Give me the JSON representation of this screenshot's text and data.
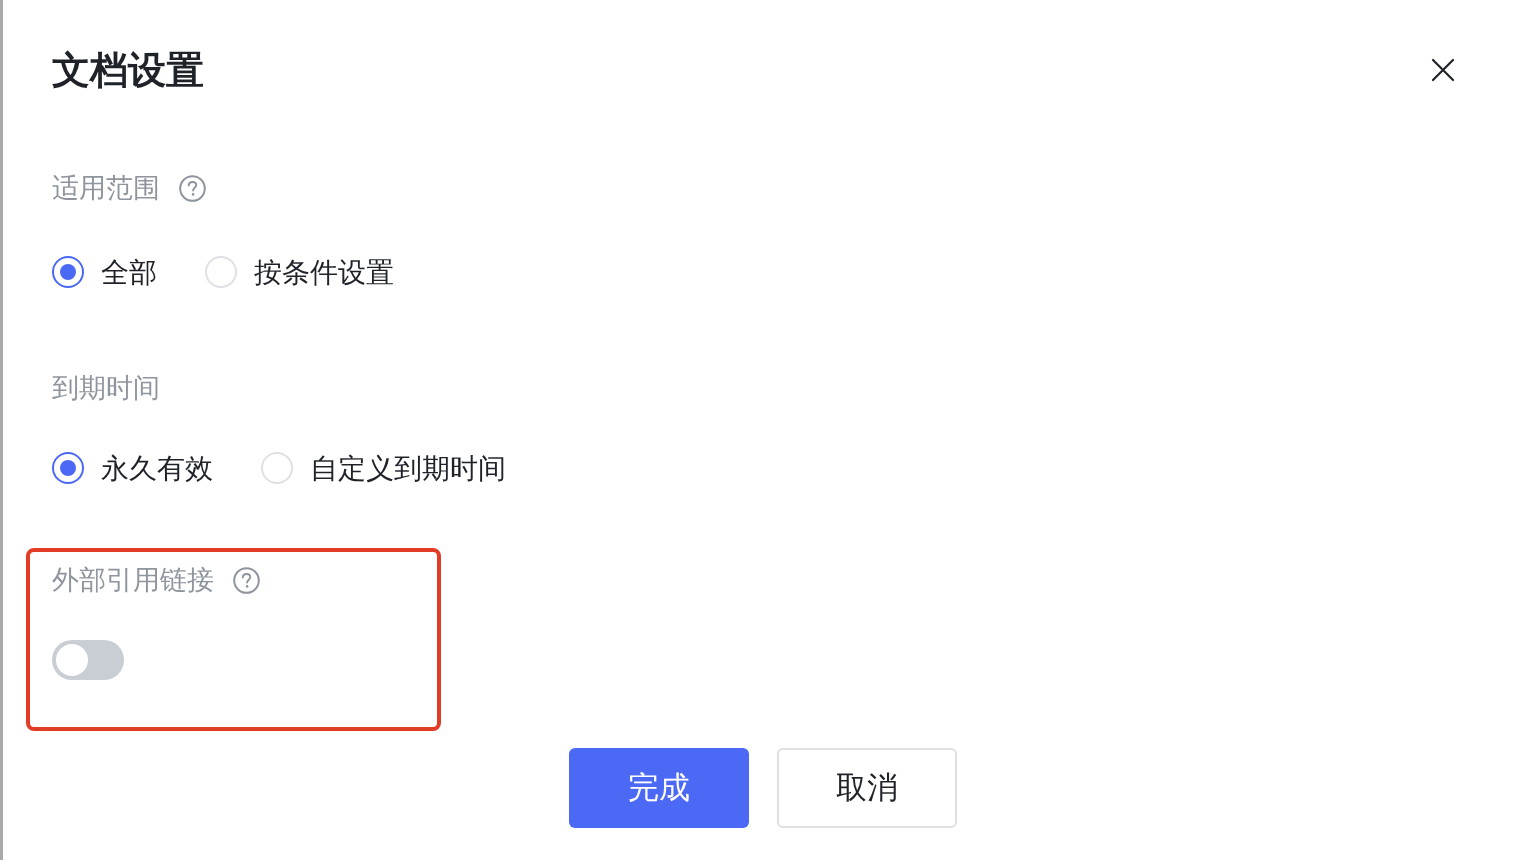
{
  "dialog": {
    "title": "文档设置"
  },
  "sections": [
    {
      "label": "适用范围",
      "help": true,
      "highlighted": false,
      "kind": "radio",
      "options": [
        {
          "label": "全部",
          "selected": true
        },
        {
          "label": "按条件设置",
          "selected": false
        }
      ]
    },
    {
      "label": "到期时间",
      "help": false,
      "highlighted": false,
      "kind": "radio",
      "options": [
        {
          "label": "永久有效",
          "selected": true
        },
        {
          "label": "自定义到期时间",
          "selected": false
        }
      ]
    },
    {
      "label": "外部引用链接",
      "help": true,
      "highlighted": true,
      "kind": "toggle",
      "on": false
    }
  ],
  "buttons": [
    {
      "label": "完成",
      "kind": "primary"
    },
    {
      "label": "取消",
      "kind": "secondary"
    }
  ]
}
